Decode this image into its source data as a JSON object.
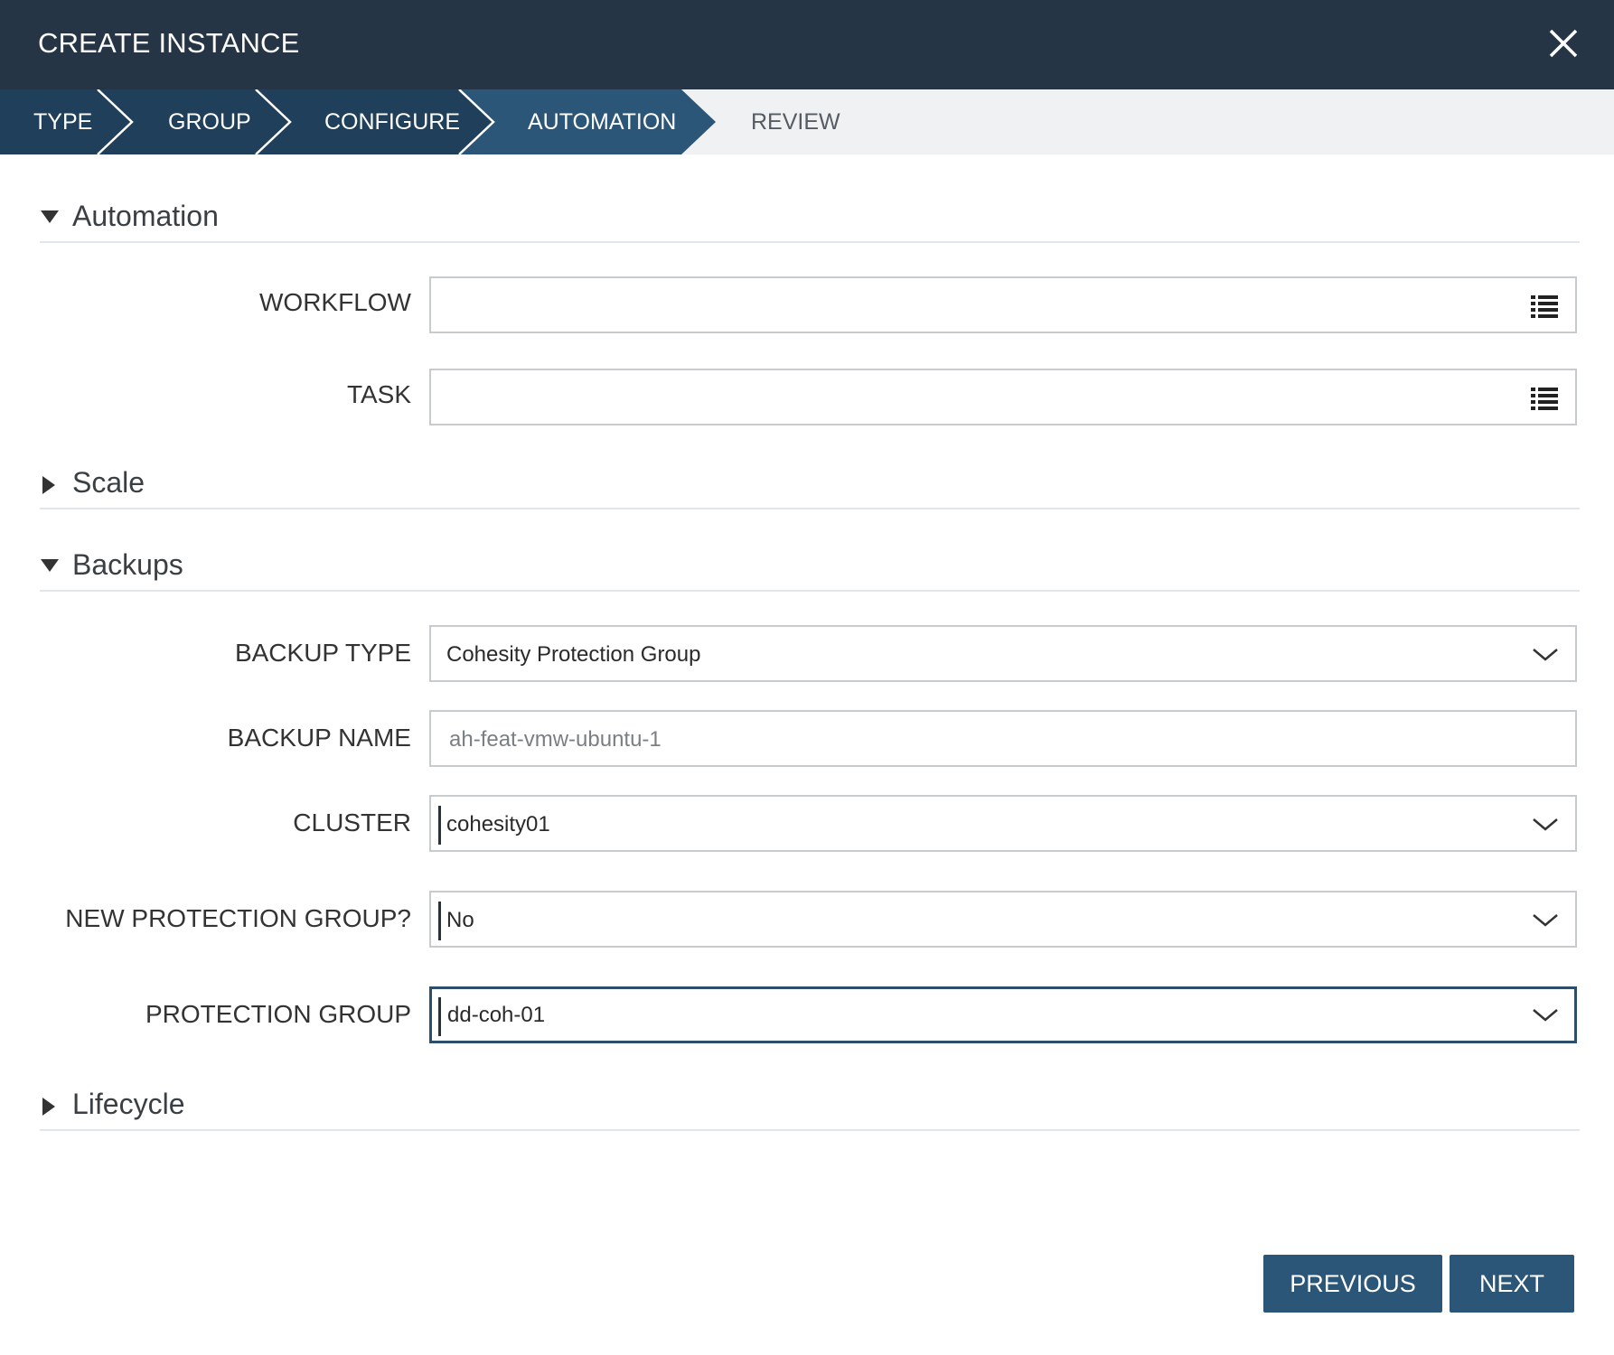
{
  "header": {
    "title": "CREATE INSTANCE"
  },
  "steps": [
    {
      "label": "TYPE",
      "state": "done"
    },
    {
      "label": "GROUP",
      "state": "done"
    },
    {
      "label": "CONFIGURE",
      "state": "done"
    },
    {
      "label": "AUTOMATION",
      "state": "active"
    },
    {
      "label": "REVIEW",
      "state": "pending"
    }
  ],
  "sections": {
    "automation": {
      "label": "Automation",
      "expanded": true
    },
    "scale": {
      "label": "Scale",
      "expanded": false
    },
    "backups": {
      "label": "Backups",
      "expanded": true
    },
    "lifecycle": {
      "label": "Lifecycle",
      "expanded": false
    }
  },
  "automation": {
    "workflow_label": "WORKFLOW",
    "workflow_value": "",
    "task_label": "TASK",
    "task_value": ""
  },
  "backups": {
    "backup_type_label": "BACKUP TYPE",
    "backup_type_value": "Cohesity Protection Group",
    "backup_name_label": "BACKUP NAME",
    "backup_name_value": "ah-feat-vmw-ubuntu-1",
    "cluster_label": "CLUSTER",
    "cluster_value": "cohesity01",
    "new_group_label": "NEW PROTECTION GROUP?",
    "new_group_value": "No",
    "protection_group_label": "PROTECTION GROUP",
    "protection_group_value": "dd-coh-01"
  },
  "footer": {
    "previous_label": "PREVIOUS",
    "next_label": "NEXT"
  },
  "colors": {
    "header_bg": "#263545",
    "step_done": "#1f3f5a",
    "step_active": "#2c5677",
    "accent_button": "#2c5677"
  },
  "icons": {
    "close": "close-icon",
    "list": "list-icon",
    "dropdown": "chevron-down-icon",
    "expanded": "triangle-down-icon",
    "collapsed": "triangle-right-icon"
  }
}
